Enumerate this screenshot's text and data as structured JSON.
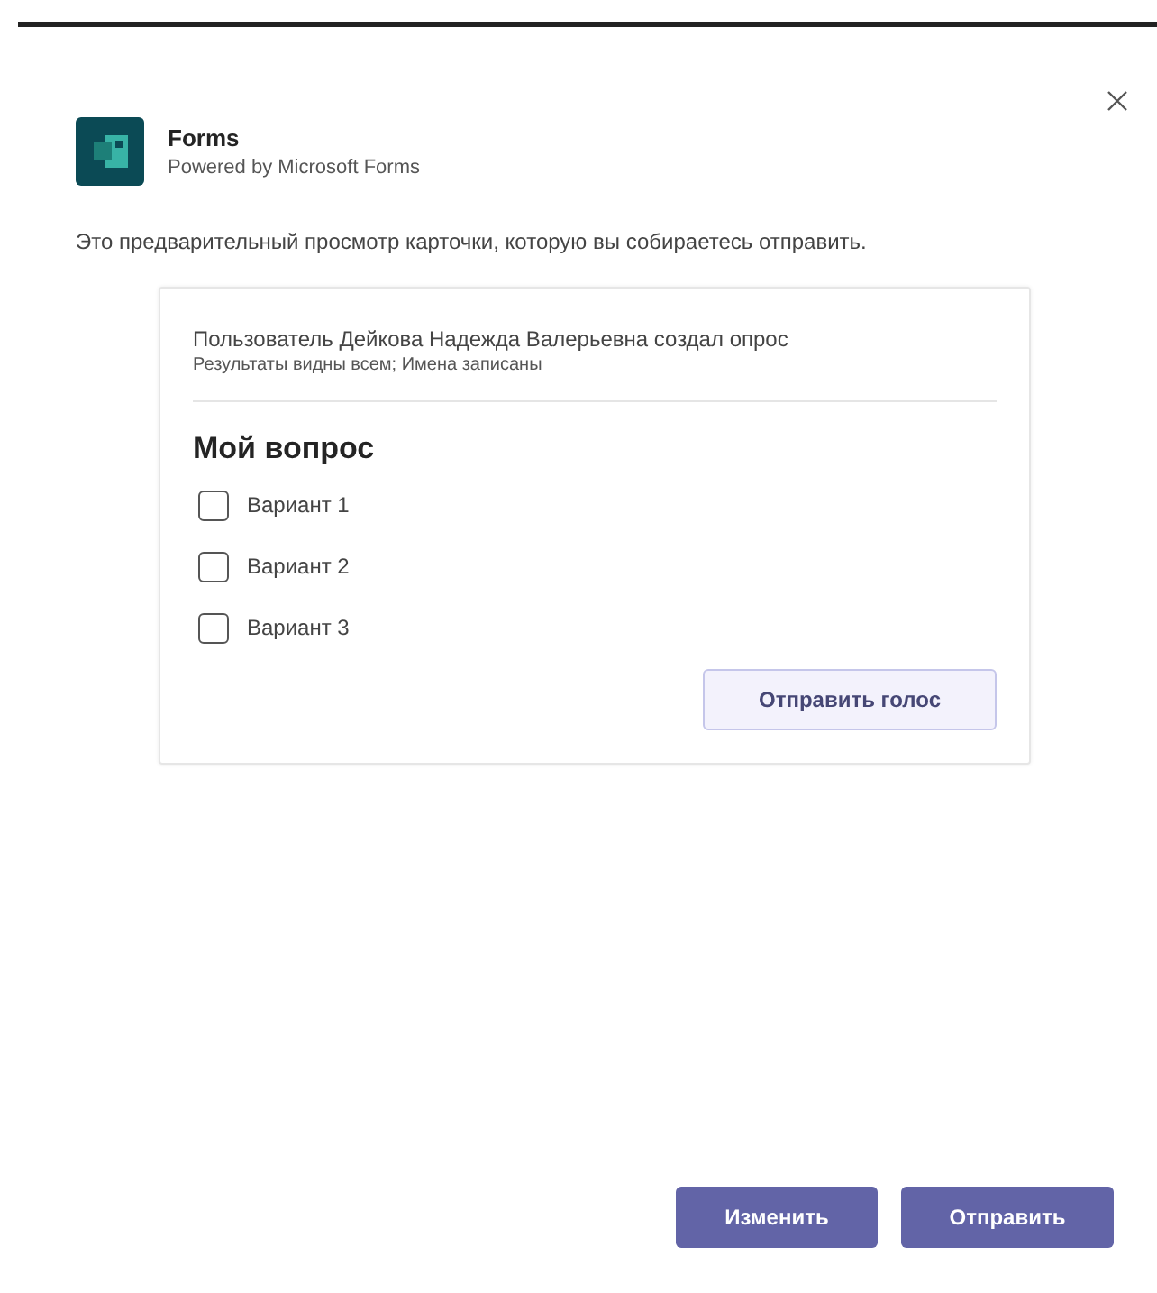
{
  "app": {
    "name": "Forms",
    "subtitle": "Powered by Microsoft Forms"
  },
  "description": "Это предварительный просмотр карточки, которую вы собираетесь отправить.",
  "card": {
    "author_line": "Пользователь Дейкова Надежда Валерьевна создал опрос",
    "settings_line": "Результаты видны всем; Имена записаны",
    "question": "Мой вопрос",
    "options": [
      {
        "label": "Вариант 1",
        "checked": false
      },
      {
        "label": "Вариант 2",
        "checked": false
      },
      {
        "label": "Вариант 3",
        "checked": false
      }
    ],
    "submit_button": "Отправить голос"
  },
  "buttons": [
    "Изменить",
    "Отправить"
  ]
}
